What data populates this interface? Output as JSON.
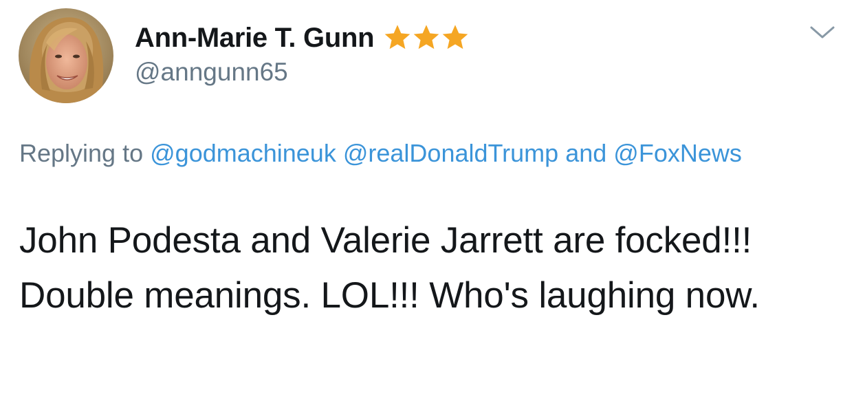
{
  "tweet": {
    "author": {
      "display_name": "Ann-Marie T. Gunn",
      "handle": "@anngunn65",
      "avatar_icon": "profile-photo",
      "badges": [
        "star-icon",
        "star-icon",
        "star-icon"
      ],
      "badge_color": "#f5a623"
    },
    "menu_icon": "chevron-down-icon",
    "reply": {
      "prefix": "Replying to",
      "mention_1": "@godmachineuk",
      "mention_2": "@realDonaldTrump",
      "connector": "and",
      "mention_3": "@FoxNews"
    },
    "text": "John Podesta and Valerie Jarrett are focked!!! Double meanings. LOL!!! Who's laughing now."
  },
  "colors": {
    "link": "#3b94d9",
    "secondary_text": "#657786",
    "primary_text": "#14171a"
  }
}
